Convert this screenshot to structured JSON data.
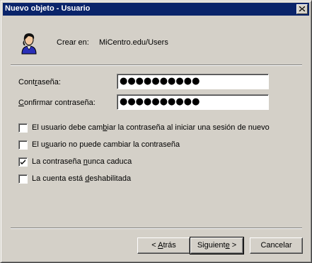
{
  "window": {
    "title": "Nuevo objeto - Usuario"
  },
  "header": {
    "create_in_label": "Crear en:",
    "create_in_value": "MiCentro.edu/Users",
    "icon": "user-icon"
  },
  "fields": {
    "password": {
      "label_before": "Cont",
      "label_accel": "r",
      "label_after": "aseña:",
      "value": "●●●●●●●●●●"
    },
    "confirm": {
      "label_before": "",
      "label_accel": "C",
      "label_after": "onfirmar contraseña:",
      "value": "●●●●●●●●●●"
    }
  },
  "options": [
    {
      "before": "El usuario debe cam",
      "accel": "b",
      "after": "iar la contraseña al iniciar una sesión de nuevo",
      "checked": false
    },
    {
      "before": "El u",
      "accel": "s",
      "after": "uario no puede cambiar la contraseña",
      "checked": false
    },
    {
      "before": "La contraseña ",
      "accel": "n",
      "after": "unca caduca",
      "checked": true
    },
    {
      "before": "La cuenta está ",
      "accel": "d",
      "after": "eshabilitada",
      "checked": false
    }
  ],
  "buttons": {
    "back": {
      "before": "< ",
      "accel": "A",
      "after": "trás"
    },
    "next": {
      "before": "Siguient",
      "accel": "e",
      "after": " >"
    },
    "cancel": {
      "label": "Cancelar"
    }
  },
  "colors": {
    "titlebar": "#0a246a",
    "face": "#d4d0c8"
  }
}
